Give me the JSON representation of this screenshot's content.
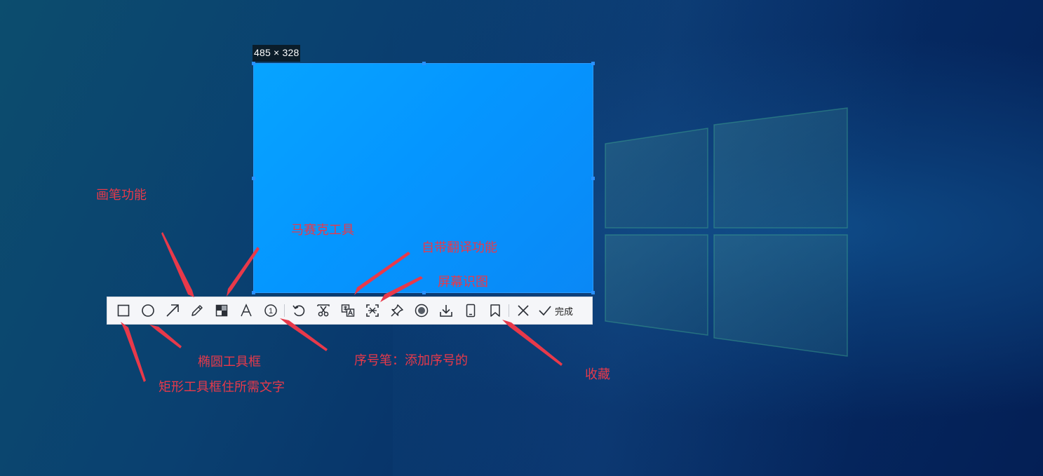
{
  "capture": {
    "size_label": "485 × 328",
    "selection_color": "#0596ff"
  },
  "toolbar": {
    "tools": [
      {
        "name": "rectangle-tool",
        "icon": "square-icon"
      },
      {
        "name": "ellipse-tool",
        "icon": "circle-icon"
      },
      {
        "name": "arrow-tool",
        "icon": "arrow-icon"
      },
      {
        "name": "pen-tool",
        "icon": "pencil-icon"
      },
      {
        "name": "mosaic-tool",
        "icon": "mosaic-icon"
      },
      {
        "name": "text-tool",
        "icon": "text-a-icon"
      },
      {
        "name": "number-pen-tool",
        "icon": "numbered-circle-icon",
        "glyph": "1"
      },
      {
        "name": "undo-tool",
        "icon": "undo-icon"
      },
      {
        "name": "cut-tool",
        "icon": "scissors-icon"
      },
      {
        "name": "translate-tool",
        "icon": "translate-icon"
      },
      {
        "name": "screen-recognition-tool",
        "icon": "scan-icon"
      },
      {
        "name": "pin-tool",
        "icon": "pin-icon"
      },
      {
        "name": "record-tool",
        "icon": "record-icon"
      },
      {
        "name": "download-tool",
        "icon": "download-icon"
      },
      {
        "name": "phone-tool",
        "icon": "phone-icon"
      },
      {
        "name": "bookmark-tool",
        "icon": "bookmark-icon"
      },
      {
        "name": "close-tool",
        "icon": "close-icon"
      }
    ],
    "done_label": "完成"
  },
  "annotations": {
    "pen": "画笔功能",
    "mosaic": "马赛克工具",
    "translate": "自带翻译功能",
    "recognition": "屏幕识图",
    "ellipse": "椭圆工具框",
    "rectangle": "矩形工具框住所需文字",
    "number_pen": "序号笔：添加序号的",
    "favorite": "收藏"
  },
  "colors": {
    "annotation_red": "#e8394a",
    "toolbar_bg": "#f5f6f9",
    "icon_dark": "#2b2f36"
  }
}
